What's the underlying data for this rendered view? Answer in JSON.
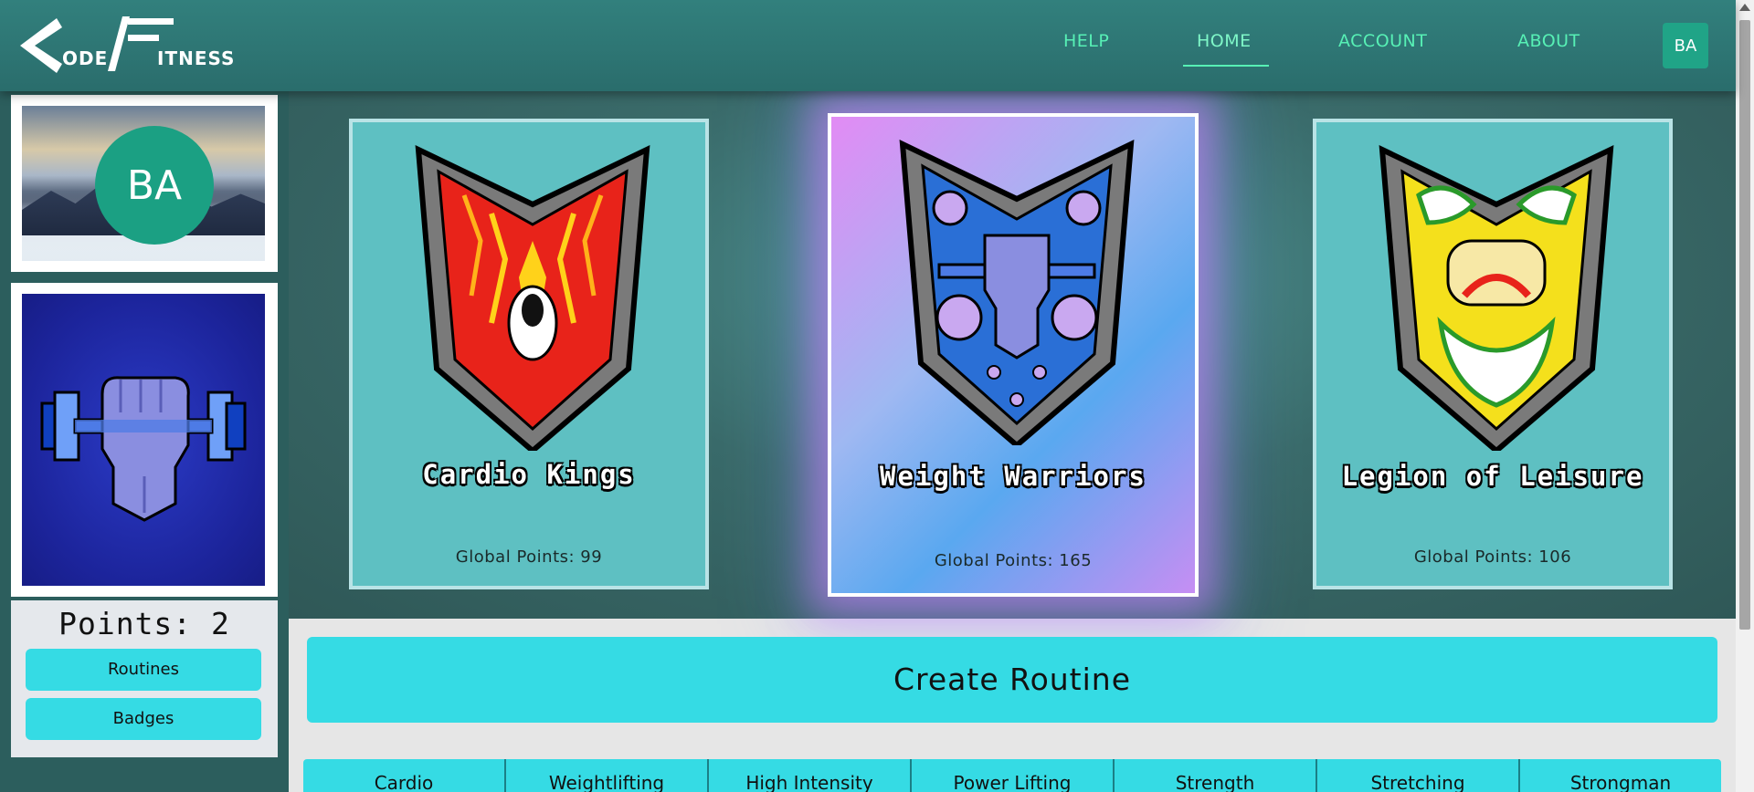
{
  "brand": {
    "logo_code": "ODE",
    "logo_fitness": "ITNESS"
  },
  "nav": {
    "help": "HELP",
    "home": "HOME",
    "account": "ACCOUNT",
    "about": "ABOUT",
    "avatar_initials": "BA",
    "active": "HOME"
  },
  "sidebar": {
    "profile_initials": "BA",
    "points_label": "Points: 2",
    "buttons": [
      "Routines",
      "Badges"
    ]
  },
  "teams": [
    {
      "name": "Cardio Kings",
      "points": "Global Points: 99",
      "color": "#e8231a"
    },
    {
      "name": "Weight Warriors",
      "points": "Global Points: 165",
      "color": "#2a6fd6",
      "featured": true
    },
    {
      "name": "Legion of Leisure",
      "points": "Global Points: 106",
      "color": "#f4e01c"
    }
  ],
  "main": {
    "create_routine": "Create Routine",
    "categories": [
      "Cardio",
      "Weightlifting",
      "High Intensity",
      "Power Lifting",
      "Strength",
      "Stretching",
      "Strongman"
    ]
  },
  "colors": {
    "accent": "#35dbe4",
    "nav_text": "#57f0b5",
    "avatar": "#1ba083",
    "header": "#2f7775"
  }
}
